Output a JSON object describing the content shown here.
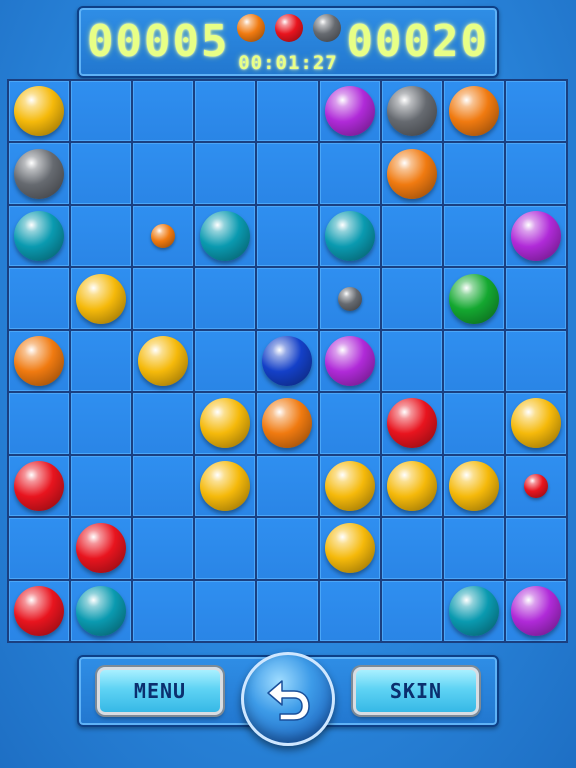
{
  "hud": {
    "score": "00005",
    "best": "00020",
    "timer": "00:01:27",
    "next_balls": [
      "orange",
      "red",
      "gray"
    ]
  },
  "colors": {
    "orange": "#f07a10",
    "red": "#e8141e",
    "gray": "#666a70",
    "yellow": "#f5b90a",
    "purple": "#b02ad8",
    "teal": "#0a9ab0",
    "green": "#14a830",
    "blue": "#1440c8"
  },
  "board": {
    "rows": 9,
    "cols": 9,
    "balls": [
      {
        "row": 0,
        "col": 0,
        "color": "yellow",
        "size": "big"
      },
      {
        "row": 0,
        "col": 5,
        "color": "purple",
        "size": "big"
      },
      {
        "row": 0,
        "col": 6,
        "color": "gray",
        "size": "big"
      },
      {
        "row": 0,
        "col": 7,
        "color": "orange",
        "size": "big"
      },
      {
        "row": 1,
        "col": 0,
        "color": "gray",
        "size": "big"
      },
      {
        "row": 1,
        "col": 6,
        "color": "orange",
        "size": "big"
      },
      {
        "row": 2,
        "col": 0,
        "color": "teal",
        "size": "big"
      },
      {
        "row": 2,
        "col": 2,
        "color": "orange",
        "size": "small"
      },
      {
        "row": 2,
        "col": 3,
        "color": "teal",
        "size": "big"
      },
      {
        "row": 2,
        "col": 5,
        "color": "teal",
        "size": "big"
      },
      {
        "row": 2,
        "col": 8,
        "color": "purple",
        "size": "big"
      },
      {
        "row": 3,
        "col": 1,
        "color": "yellow",
        "size": "big"
      },
      {
        "row": 3,
        "col": 5,
        "color": "gray",
        "size": "small"
      },
      {
        "row": 3,
        "col": 7,
        "color": "green",
        "size": "big"
      },
      {
        "row": 4,
        "col": 0,
        "color": "orange",
        "size": "big"
      },
      {
        "row": 4,
        "col": 2,
        "color": "yellow",
        "size": "big"
      },
      {
        "row": 4,
        "col": 4,
        "color": "blue",
        "size": "big"
      },
      {
        "row": 4,
        "col": 5,
        "color": "purple",
        "size": "big"
      },
      {
        "row": 5,
        "col": 3,
        "color": "yellow",
        "size": "big"
      },
      {
        "row": 5,
        "col": 4,
        "color": "orange",
        "size": "big"
      },
      {
        "row": 5,
        "col": 6,
        "color": "red",
        "size": "big"
      },
      {
        "row": 5,
        "col": 8,
        "color": "yellow",
        "size": "big"
      },
      {
        "row": 6,
        "col": 0,
        "color": "red",
        "size": "big"
      },
      {
        "row": 6,
        "col": 3,
        "color": "yellow",
        "size": "big"
      },
      {
        "row": 6,
        "col": 5,
        "color": "yellow",
        "size": "big"
      },
      {
        "row": 6,
        "col": 6,
        "color": "yellow",
        "size": "big"
      },
      {
        "row": 6,
        "col": 7,
        "color": "yellow",
        "size": "big"
      },
      {
        "row": 6,
        "col": 8,
        "color": "red",
        "size": "small"
      },
      {
        "row": 7,
        "col": 1,
        "color": "red",
        "size": "big"
      },
      {
        "row": 7,
        "col": 5,
        "color": "yellow",
        "size": "big"
      },
      {
        "row": 8,
        "col": 0,
        "color": "red",
        "size": "big"
      },
      {
        "row": 8,
        "col": 1,
        "color": "teal",
        "size": "big"
      },
      {
        "row": 8,
        "col": 7,
        "color": "teal",
        "size": "big"
      },
      {
        "row": 8,
        "col": 8,
        "color": "purple",
        "size": "big"
      }
    ]
  },
  "controls": {
    "menu_label": "MENU",
    "skin_label": "SKIN",
    "undo_icon": "undo-arrow-icon"
  }
}
